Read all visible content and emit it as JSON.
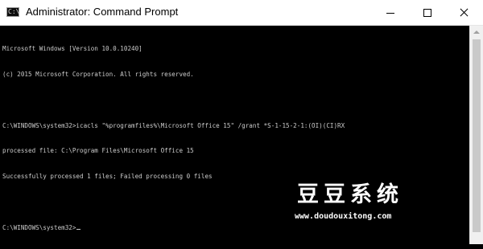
{
  "window": {
    "title": "Administrator: Command Prompt",
    "icon": "cmd-icon",
    "controls": [
      "minimize-icon",
      "maximize-icon",
      "close-icon"
    ]
  },
  "console": {
    "lines": [
      "Microsoft Windows [Version 10.0.10240]",
      "(c) 2015 Microsoft Corporation. All rights reserved.",
      "",
      "C:\\WINDOWS\\system32>icacls \"%programfiles%\\Microsoft Office 15\" /grant *S-1-15-2-1:(OI)(CI)RX",
      "processed file: C:\\Program Files\\Microsoft Office 15",
      "Successfully processed 1 files; Failed processing 0 files",
      "",
      "C:\\WINDOWS\\system32>"
    ]
  },
  "watermark": {
    "title": "豆豆系统",
    "url": "www.doudouxitong.com"
  },
  "colors": {
    "console_bg": "#000000",
    "console_text": "#cccccc",
    "titlebar_bg": "#ffffff"
  }
}
